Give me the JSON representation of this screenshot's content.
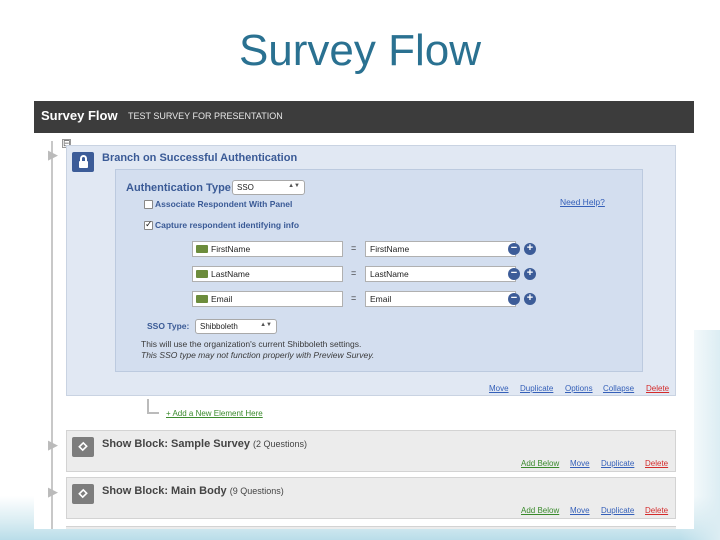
{
  "slide": {
    "title": "Survey Flow"
  },
  "app": {
    "title": "Survey Flow",
    "subtitle": "TEST SURVEY FOR PRESENTATION"
  },
  "branch": {
    "collapse_glyph": "⊟",
    "title": "Branch on Successful Authentication",
    "icon": "lock-icon",
    "auth_label": "Authentication Type:",
    "auth_value": "SSO",
    "associate_label": "Associate Respondent With Panel",
    "associate_checked": false,
    "capture_label": "Capture respondent identifying info",
    "capture_checked": true,
    "need_help": "Need Help?",
    "mappings": [
      {
        "left": "FirstName",
        "eq": "=",
        "right": "FirstName"
      },
      {
        "left": "LastName",
        "eq": "=",
        "right": "LastName"
      },
      {
        "left": "Email",
        "eq": "=",
        "right": "Email"
      }
    ],
    "sso_label": "SSO Type:",
    "sso_value": "Shibboleth",
    "note1": "This will use the organization's current Shibboleth settings.",
    "note2": "This SSO type may not function properly with Preview Survey.",
    "actions": {
      "move": "Move",
      "duplicate": "Duplicate",
      "options": "Options",
      "collapse": "Collapse",
      "delete": "Delete"
    }
  },
  "add_element": "+ Add a New Element Here",
  "blocks": [
    {
      "title": "Show Block: Sample Survey",
      "count": "(2 Questions)",
      "add_below": "Add Below",
      "move": "Move",
      "duplicate": "Duplicate",
      "delete": "Delete"
    },
    {
      "title": "Show Block: Main Body",
      "count": "(9 Questions)",
      "add_below": "Add Below",
      "move": "Move",
      "duplicate": "Duplicate",
      "delete": "Delete"
    }
  ],
  "colors": {
    "header": "#3c3c3c",
    "accent": "#3a5a96",
    "panel": "#e1e8f3",
    "link": "#3560b9",
    "delete": "#d42b2b",
    "add": "#3a8a2c",
    "slide_title": "#2a7191"
  }
}
